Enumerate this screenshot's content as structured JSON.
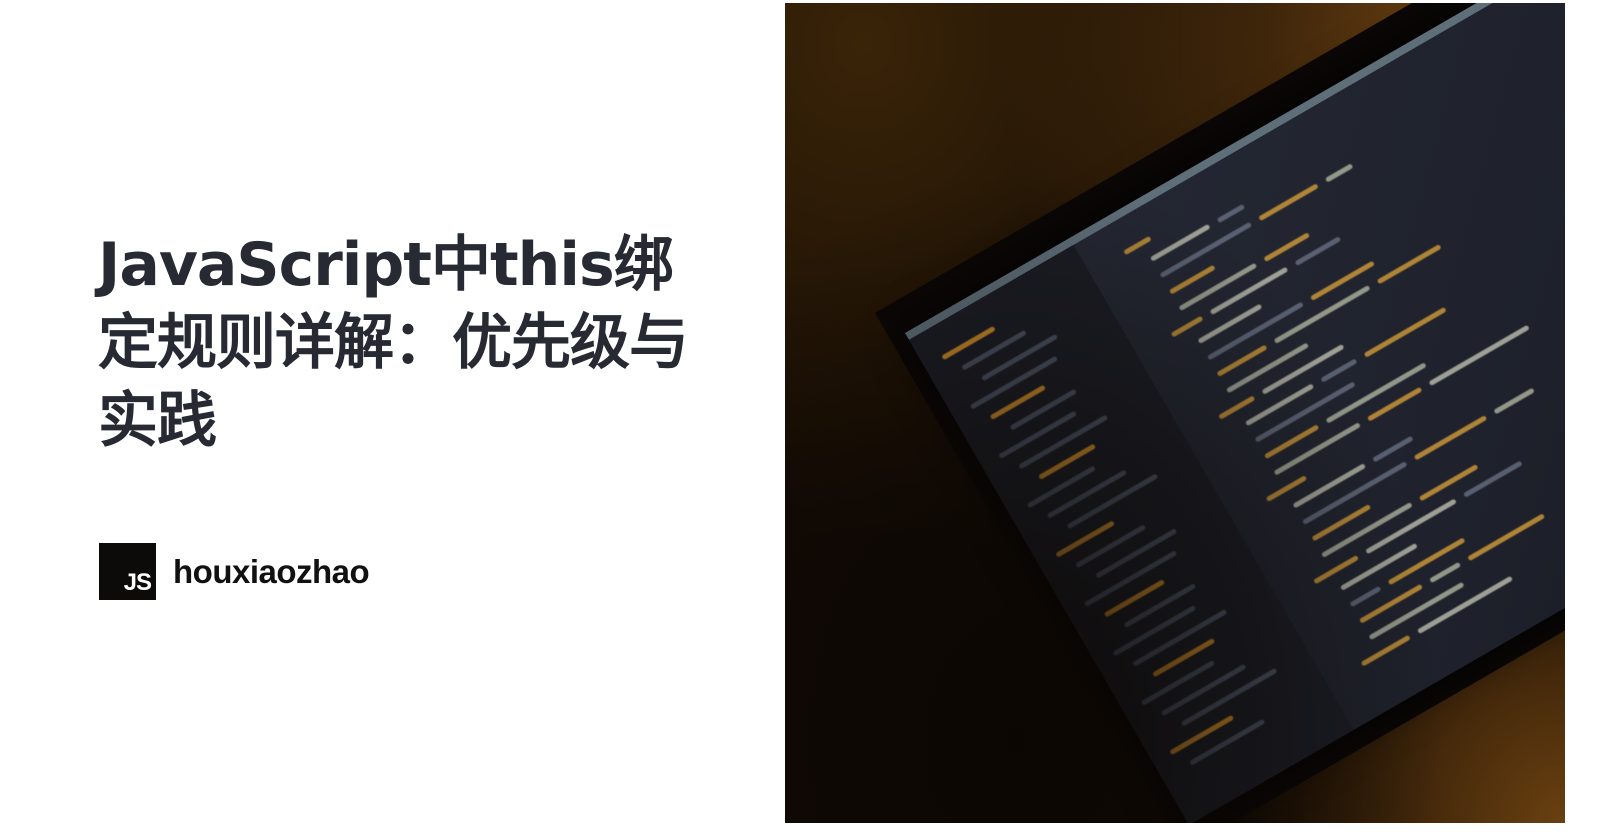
{
  "title": "JavaScript中this绑定规则详解：优先级与实践",
  "author": {
    "logo_text": "JS",
    "name": "houxiaozhao"
  },
  "colors": {
    "title": "#272a33",
    "logo_bg": "#0d0b0a",
    "photo_bg": "#120a04",
    "code_keyword": "#e0a53a"
  },
  "icons": {
    "logo": "js-logo-icon"
  }
}
